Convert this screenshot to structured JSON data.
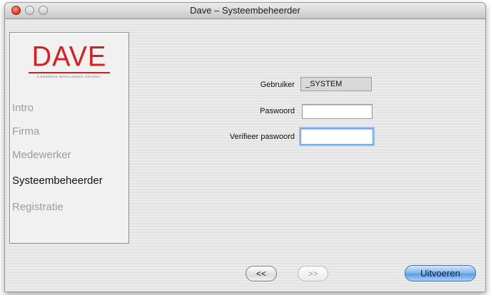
{
  "window": {
    "title": "Dave – Systeembeheerder"
  },
  "logo": {
    "text": "DAVE",
    "tagline": "A BUSINESS INTELLIGENCE ODYSSEY"
  },
  "sidebar": {
    "items": [
      {
        "label": "Intro",
        "active": false
      },
      {
        "label": "Firma",
        "active": false
      },
      {
        "label": "Medewerker",
        "active": false
      },
      {
        "label": "Systeembeheerder",
        "active": true
      },
      {
        "label": "Registratie",
        "active": false
      }
    ]
  },
  "form": {
    "user_label": "Gebruiker",
    "user_value": "_SYSTEM",
    "password_label": "Paswoord",
    "password_value": "",
    "verify_label": "Verifieer paswoord",
    "verify_value": ""
  },
  "buttons": {
    "back": "<<",
    "next": ">>",
    "run": "Uitvoeren"
  },
  "colors": {
    "logo_red": "#d81e1e",
    "active_nav": "#111111",
    "inactive_nav": "#9c9c9c",
    "default_button": "#5c9ae2"
  }
}
